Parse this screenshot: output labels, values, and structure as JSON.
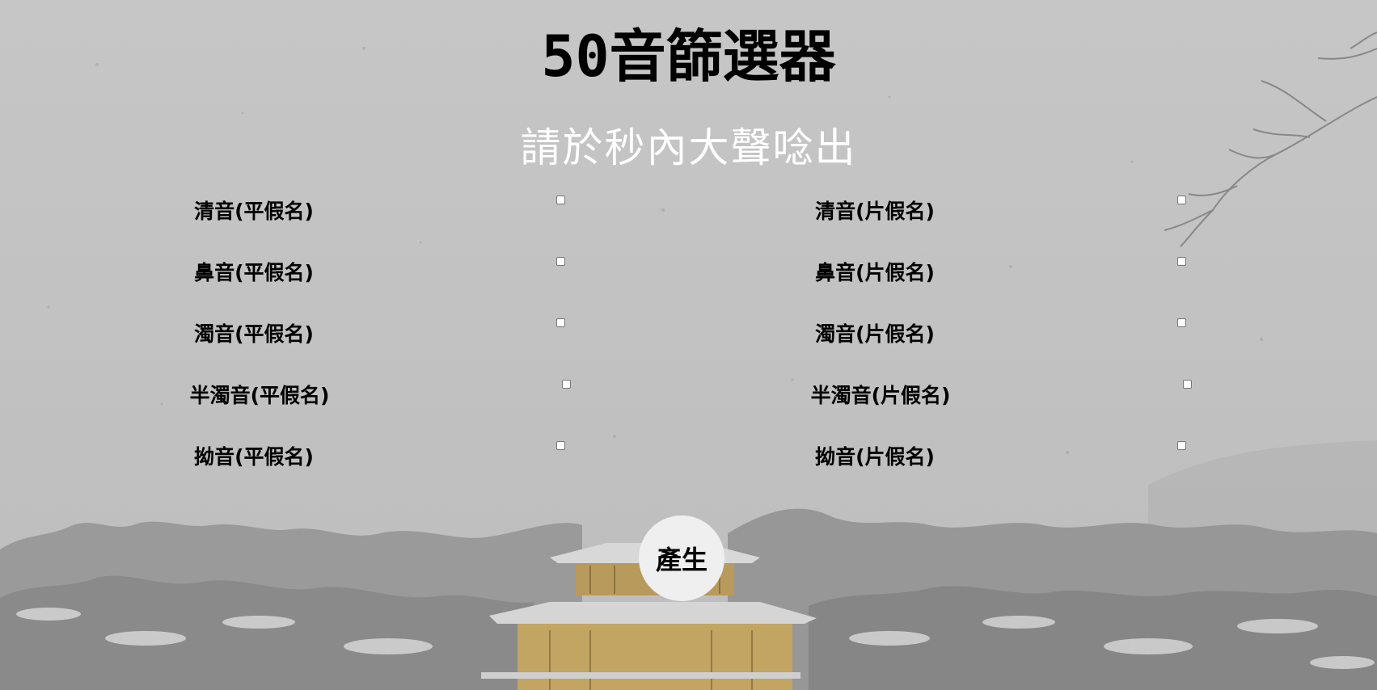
{
  "header": {
    "title": "50音篩選器",
    "subtitle": "請於秒內大聲唸出"
  },
  "options": {
    "left": [
      {
        "label": "清音(平假名)",
        "checked": false
      },
      {
        "label": "鼻音(平假名)",
        "checked": false
      },
      {
        "label": "濁音(平假名)",
        "checked": false
      },
      {
        "label": "半濁音(平假名)",
        "checked": false
      },
      {
        "label": "拗音(平假名)",
        "checked": false
      }
    ],
    "right": [
      {
        "label": "清音(片假名)",
        "checked": false
      },
      {
        "label": "鼻音(片假名)",
        "checked": false
      },
      {
        "label": "濁音(片假名)",
        "checked": false
      },
      {
        "label": "半濁音(片假名)",
        "checked": false
      },
      {
        "label": "拗音(片假名)",
        "checked": false
      }
    ]
  },
  "actions": {
    "generate_label": "產生"
  },
  "colors": {
    "title": "#000000",
    "subtitle": "#ffffff",
    "button_bg": "#efefef"
  }
}
